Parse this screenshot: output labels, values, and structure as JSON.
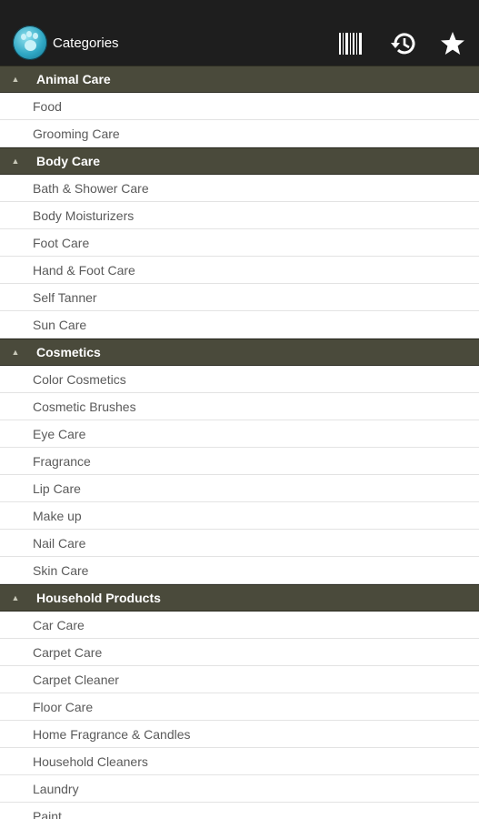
{
  "header": {
    "title": "Categories",
    "app_icon": "paw-logo-icon",
    "actions": [
      {
        "name": "barcode-scan-button",
        "icon": "barcode-icon"
      },
      {
        "name": "history-button",
        "icon": "history-icon"
      },
      {
        "name": "favorites-button",
        "icon": "star-icon"
      }
    ]
  },
  "colors": {
    "action_bar": "#1e1e1e",
    "section_header": "#4a4a3b",
    "row_text": "#5a5a5a"
  },
  "sections": [
    {
      "title": "Animal Care",
      "items": [
        "Food",
        "Grooming Care"
      ]
    },
    {
      "title": "Body Care",
      "items": [
        "Bath & Shower Care",
        "Body Moisturizers",
        "Foot Care",
        "Hand & Foot Care",
        "Self Tanner",
        "Sun Care"
      ]
    },
    {
      "title": "Cosmetics",
      "items": [
        "Color Cosmetics",
        "Cosmetic Brushes",
        "Eye Care",
        "Fragrance",
        "Lip Care",
        "Make up",
        "Nail Care",
        "Skin Care"
      ]
    },
    {
      "title": "Household Products",
      "items": [
        "Car Care",
        "Carpet Care",
        "Carpet Cleaner",
        "Floor Care",
        "Home Fragrance & Candles",
        "Household Cleaners",
        "Laundry",
        "Paint"
      ]
    }
  ]
}
